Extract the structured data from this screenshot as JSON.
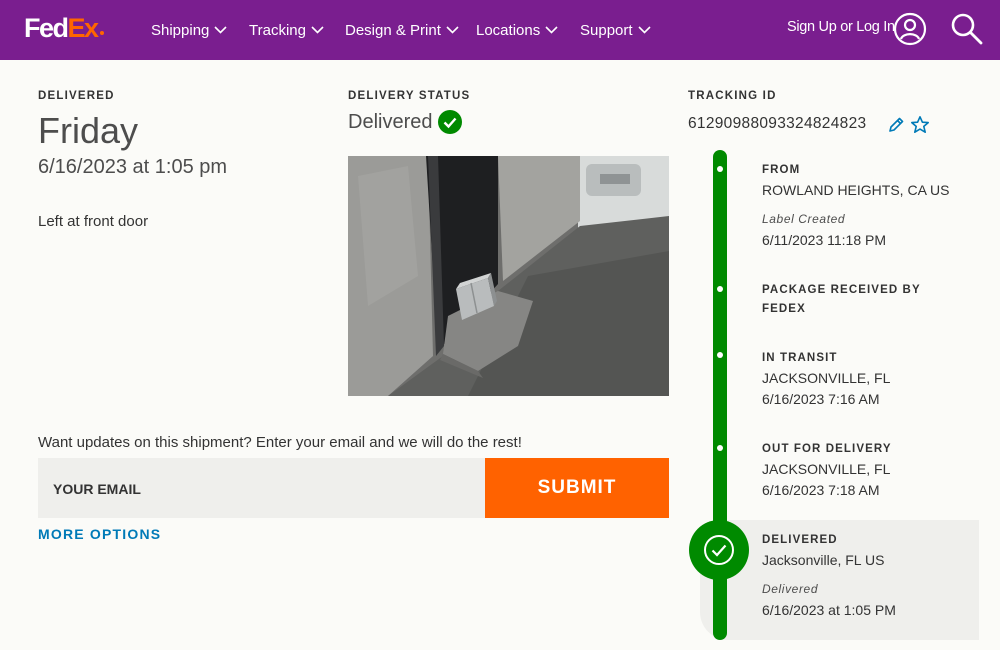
{
  "header": {
    "logo_fed": "Fed",
    "logo_ex": "Ex",
    "nav": [
      "Shipping",
      "Tracking",
      "Design & Print",
      "Locations",
      "Support"
    ],
    "signin": "Sign Up or Log In"
  },
  "delivery": {
    "label": "DELIVERED",
    "day": "Friday",
    "datetime": "6/16/2023 at 1:05 pm",
    "note": "Left at front door"
  },
  "status": {
    "label": "DELIVERY STATUS",
    "value": "Delivered"
  },
  "email_signup": {
    "prompt": "Want updates on this shipment? Enter your email and we will do the rest!",
    "placeholder": "YOUR EMAIL",
    "submit": "SUBMIT",
    "more_options": "MORE OPTIONS"
  },
  "tracking": {
    "label": "TRACKING ID",
    "id": "61290988093324824823"
  },
  "timeline": {
    "from_title": "FROM",
    "from_location": "ROWLAND HEIGHTS, CA US",
    "from_status": "Label Created",
    "from_time": "6/11/2023 11:18 PM",
    "received_title": "PACKAGE RECEIVED BY FEDEX",
    "transit_title": "IN TRANSIT",
    "transit_location": "JACKSONVILLE, FL",
    "transit_time": "6/16/2023 7:16 AM",
    "ofd_title": "OUT FOR DELIVERY",
    "ofd_location": "JACKSONVILLE, FL",
    "ofd_time": "6/16/2023 7:18 AM",
    "delivered_title": "DELIVERED",
    "delivered_location": "Jacksonville, FL US",
    "delivered_status": "Delivered",
    "delivered_time": "6/16/2023 at 1:05 PM"
  },
  "colors": {
    "header_purple": "#7a1e8f",
    "fedex_orange": "#ff6600",
    "success_green": "#008a00",
    "link_blue": "#007ab7"
  },
  "icons": [
    "chevron-down-icon",
    "user-icon",
    "search-icon",
    "check-circle-icon",
    "pencil-icon",
    "star-icon"
  ]
}
